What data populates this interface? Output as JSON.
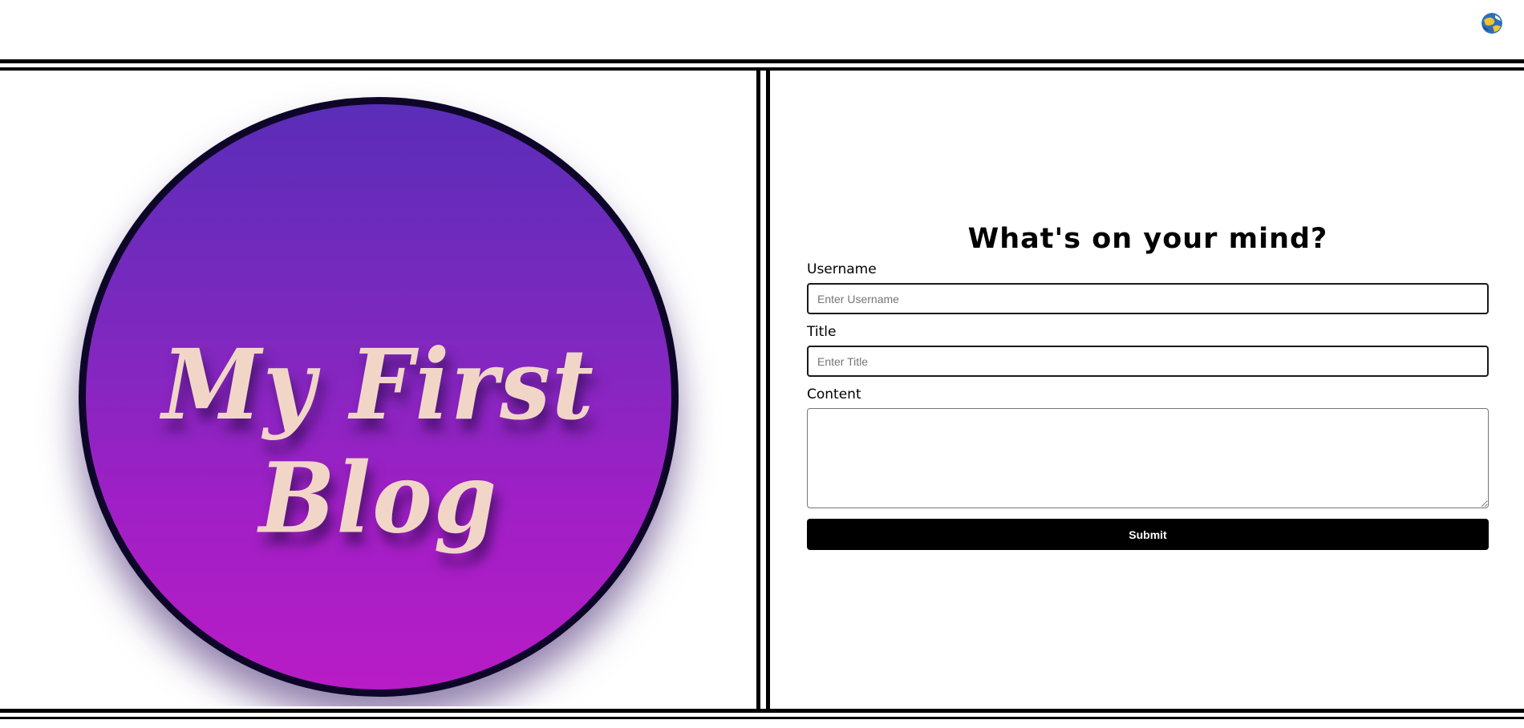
{
  "header": {
    "globe_icon": "globe-icon"
  },
  "hero": {
    "logo_text": "My First Blog",
    "colors": {
      "gradient_top": "#5a2db8",
      "gradient_bottom": "#b81cc6",
      "ring": "#0d0628",
      "text": "#f1d6c8"
    }
  },
  "form": {
    "title": "What's on your mind?",
    "username_label": "Username",
    "username_placeholder": "Enter Username",
    "username_value": "",
    "title_label": "Title",
    "title_placeholder": "Enter Title",
    "title_value": "",
    "content_label": "Content",
    "content_value": "",
    "submit_label": "Submit",
    "submit_color": "#000000"
  }
}
